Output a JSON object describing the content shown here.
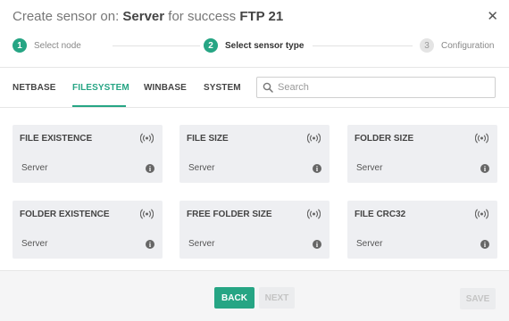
{
  "header": {
    "title_prefix": "Create sensor on: ",
    "device": "Server",
    "title_middle": " for success ",
    "group": "FTP 21",
    "close_glyph": "✕"
  },
  "steps": [
    {
      "num": "1",
      "label": "Select node",
      "state": "done"
    },
    {
      "num": "2",
      "label": "Select sensor type",
      "state": "active"
    },
    {
      "num": "3",
      "label": "Configuration",
      "state": "inactive"
    }
  ],
  "tabs": [
    {
      "label": "NETBASE",
      "active": false
    },
    {
      "label": "FILESYSTEM",
      "active": true
    },
    {
      "label": "WINBASE",
      "active": false
    },
    {
      "label": "SYSTEM",
      "active": false
    }
  ],
  "search": {
    "placeholder": "Search",
    "value": "",
    "icon": "search-icon"
  },
  "cards": [
    {
      "title": "FILE EXISTENCE",
      "device": "Server",
      "icon": "wireless-signal-icon",
      "info_icon": "info-icon"
    },
    {
      "title": "FILE SIZE",
      "device": "Server",
      "icon": "wireless-signal-icon",
      "info_icon": "info-icon"
    },
    {
      "title": "FOLDER SIZE",
      "device": "Server",
      "icon": "wireless-signal-icon",
      "info_icon": "info-icon"
    },
    {
      "title": "FOLDER EXISTENCE",
      "device": "Server",
      "icon": "wireless-signal-icon",
      "info_icon": "info-icon"
    },
    {
      "title": "FREE FOLDER SIZE",
      "device": "Server",
      "icon": "wireless-signal-icon",
      "info_icon": "info-icon"
    },
    {
      "title": "FILE CRC32",
      "device": "Server",
      "icon": "wireless-signal-icon",
      "info_icon": "info-icon"
    }
  ],
  "footer": {
    "back_label": "BACK",
    "next_label": "NEXT",
    "save_label": "SAVE"
  },
  "colors": {
    "accent": "#26a584",
    "card_bg": "#eeeff2",
    "disabled_text": "#c4c4c4"
  }
}
